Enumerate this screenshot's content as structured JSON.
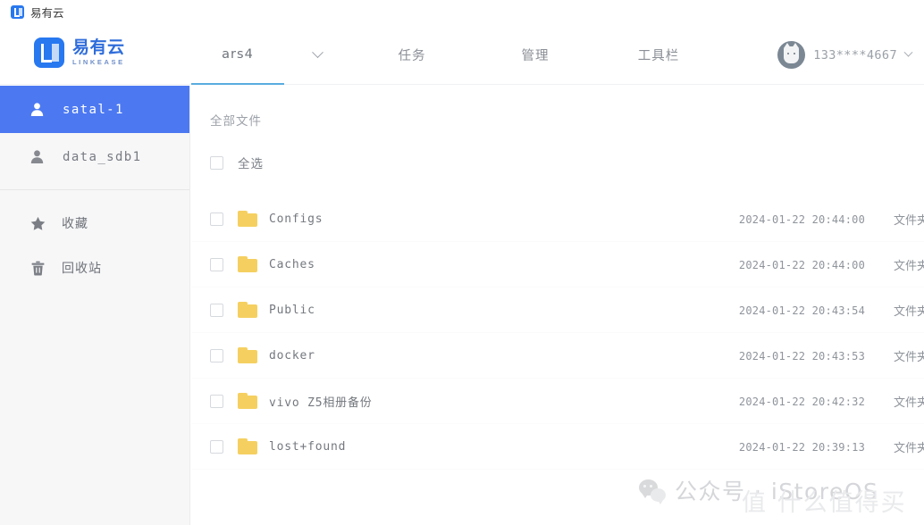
{
  "browser": {
    "tab_title": "易有云",
    "favicon": "linkease-logo-icon"
  },
  "header": {
    "brand_cn": "易有云",
    "brand_en": "LINKEASE",
    "tabs": [
      {
        "label": "ars4",
        "active": true,
        "name": "tab-ars4"
      },
      {
        "label": "",
        "icon": "chevron-down-icon",
        "active": false,
        "name": "tab-dropdown"
      },
      {
        "label": "任务",
        "active": false,
        "name": "tab-tasks"
      },
      {
        "label": "管理",
        "active": false,
        "name": "tab-manage"
      },
      {
        "label": "工具栏",
        "active": false,
        "name": "tab-toolbar"
      }
    ],
    "user": {
      "name": "133****4667",
      "avatar": "cat-avatar-icon",
      "chevron": "chevron-down-icon"
    },
    "active_underline_color": "#5AACDF"
  },
  "sidebar": {
    "background": "#F7F7F8",
    "active_color": "#4C79F2",
    "items": [
      {
        "label": "satal-1",
        "icon": "user-icon",
        "active": true
      },
      {
        "label": "data_sdb1",
        "icon": "user-icon",
        "active": false
      }
    ],
    "items2": [
      {
        "label": "收藏",
        "icon": "star-icon",
        "active": false
      },
      {
        "label": "回收站",
        "icon": "trash-icon",
        "active": false
      }
    ]
  },
  "main": {
    "breadcrumb": "全部文件",
    "select_all_label": "全选",
    "files": [
      {
        "name": "Configs",
        "icon": "folder-icon",
        "date": "2024-01-22 20:44:00",
        "type": "文件夹"
      },
      {
        "name": "Caches",
        "icon": "folder-icon",
        "date": "2024-01-22 20:44:00",
        "type": "文件夹"
      },
      {
        "name": "Public",
        "icon": "folder-icon",
        "date": "2024-01-22 20:43:54",
        "type": "文件夹"
      },
      {
        "name": "docker",
        "icon": "folder-icon",
        "date": "2024-01-22 20:43:53",
        "type": "文件夹"
      },
      {
        "name": "vivo Z5相册备份",
        "icon": "folder-icon",
        "date": "2024-01-22 20:42:32",
        "type": "文件夹"
      },
      {
        "name": "lost+found",
        "icon": "folder-icon",
        "date": "2024-01-22 20:39:13",
        "type": "文件夹"
      }
    ],
    "folder_color": "#F5D061"
  },
  "watermark": {
    "wechat_text": "公众号 · iStoreOS",
    "wechat_icon": "wechat-icon",
    "overlay_text": "值 什么值得买"
  }
}
